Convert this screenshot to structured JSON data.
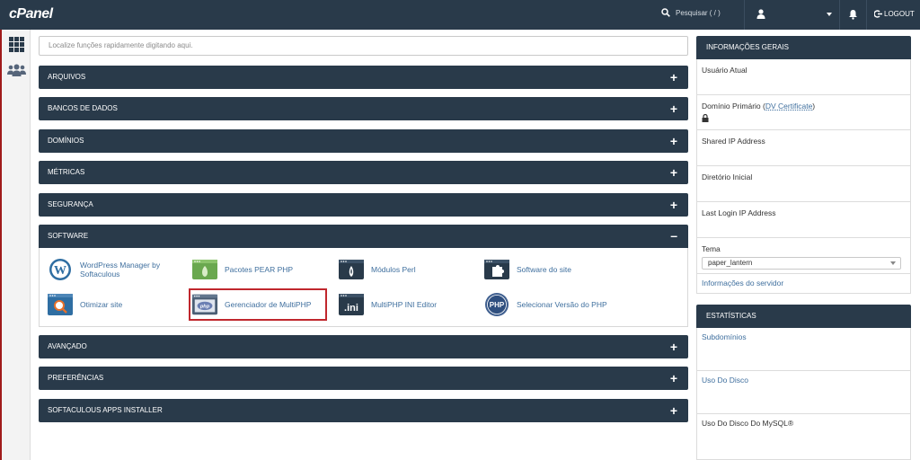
{
  "topbar": {
    "logo": "cPanel",
    "search_placeholder": "Pesquisar ( / )",
    "logout_label": "LOGOUT"
  },
  "quick_find": {
    "placeholder": "Localize funções rapidamente digitando aqui."
  },
  "sections": {
    "arquivos": "ARQUIVOS",
    "bancos": "BANCOS DE DADOS",
    "dominios": "DOMÍNIOS",
    "metricas": "MÉTRICAS",
    "seguranca": "SEGURANÇA",
    "software": "SOFTWARE",
    "avancado": "AVANÇADO",
    "preferencias": "PREFERÊNCIAS",
    "softaculous": "SOFTACULOUS APPS INSTALLER"
  },
  "software_items": {
    "wordpress_line1": "WordPress Manager by",
    "wordpress_line2": "Softaculous",
    "pear": "Pacotes PEAR PHP",
    "perl": "Módulos Perl",
    "site_software": "Software do site",
    "optimize": "Otimizar site",
    "multiphp_manager": "Gerenciador de MultiPHP",
    "multiphp_ini": "MultiPHP INI Editor",
    "php_version": "Selecionar Versão do PHP"
  },
  "general_info": {
    "title": "INFORMAÇÕES GERAIS",
    "current_user": "Usuário Atual",
    "primary_domain": "Domínio Primário (",
    "dv_link": "DV Certificate",
    "primary_domain_close": ")",
    "shared_ip": "Shared IP Address",
    "home_dir": "Diretório Inicial",
    "last_login": "Last Login IP Address",
    "theme_label": "Tema",
    "theme_value": "paper_lantern",
    "server_info": "Informações do servidor"
  },
  "stats": {
    "title": "ESTATÍSTICAS",
    "subdomains": "Subdomínios",
    "disk_usage": "Uso Do Disco",
    "mysql_disk": "Uso Do Disco Do MySQL®"
  },
  "colors": {
    "header": "#293a4a",
    "link": "#3f6f9e",
    "highlight": "#c0272d"
  }
}
